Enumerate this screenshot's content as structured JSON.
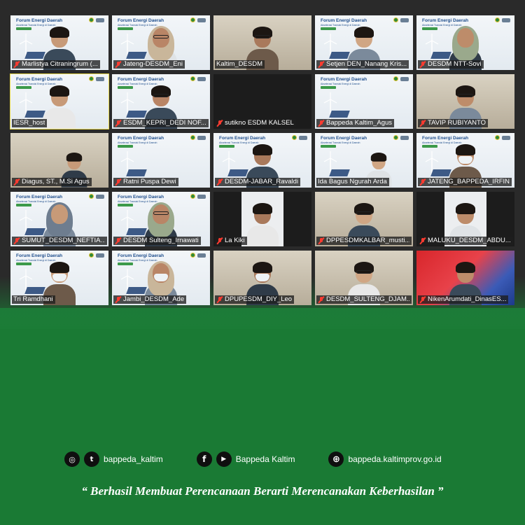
{
  "meeting": {
    "background_title": "Forum Energi Daerah",
    "background_subtitle": "Akselerasi Transisi Energi di Daerah",
    "participants": [
      {
        "name": "Marlistya Citraningrum (...",
        "muted": true,
        "bg": "forum",
        "person": "woman"
      },
      {
        "name": "Jateng-DESDM_Eni",
        "muted": true,
        "bg": "forum",
        "person": "hijab-glasses"
      },
      {
        "name": "Kaltim_DESDM",
        "muted": false,
        "bg": "room",
        "person": "man-glasses"
      },
      {
        "name": "Setjen DEN_Nanang Kris...",
        "muted": true,
        "bg": "forum",
        "person": "man"
      },
      {
        "name": "DESDM NTT-Sovi",
        "muted": true,
        "bg": "forum",
        "person": "hijab"
      },
      {
        "name": "IESR_host",
        "muted": false,
        "bg": "forum",
        "person": "woman",
        "highlight": true
      },
      {
        "name": "ESDM_KEPRI_DEDI NOF...",
        "muted": true,
        "bg": "forum",
        "person": "man-glasses"
      },
      {
        "name": "sutikno ESDM KALSEL",
        "muted": true,
        "bg": "dark",
        "person": "none"
      },
      {
        "name": "Bappeda Kaltim_Agus",
        "muted": true,
        "bg": "forum",
        "person": "none"
      },
      {
        "name": "TAVIP RUBIYANTO",
        "muted": true,
        "bg": "room",
        "person": "man-glasses"
      },
      {
        "name": "Diagus, ST., M.Si Agus",
        "muted": true,
        "bg": "room",
        "person": "man-small"
      },
      {
        "name": "Ratni Puspa Dewi",
        "muted": true,
        "bg": "forum",
        "person": "none"
      },
      {
        "name": "DESDM-JABAR_Ravaldi",
        "muted": true,
        "bg": "forum",
        "person": "man"
      },
      {
        "name": "Ida Bagus Ngurah Arda",
        "muted": false,
        "bg": "forum",
        "person": "man-small"
      },
      {
        "name": "JATENG_BAPPEDA_IRFIN",
        "muted": true,
        "bg": "forum",
        "person": "man-mask"
      },
      {
        "name": "SUMUT_DESDM_NEFTIA...",
        "muted": true,
        "bg": "forum",
        "person": "hijab"
      },
      {
        "name": "DESDM Sulteng_Irnawati",
        "muted": true,
        "bg": "forum",
        "person": "hijab-glasses"
      },
      {
        "name": "La Kiki",
        "muted": true,
        "bg": "dark",
        "person": "man"
      },
      {
        "name": "DPPESDMKALBAR_musti...",
        "muted": true,
        "bg": "room",
        "person": "man-glasses"
      },
      {
        "name": "MALUKU_DESDM_ABDU...",
        "muted": true,
        "bg": "dark",
        "person": "man"
      },
      {
        "name": "Tri Ramdhani",
        "muted": false,
        "bg": "forum",
        "person": "man-mask"
      },
      {
        "name": "Jambi_DESDM_Ade",
        "muted": true,
        "bg": "forum",
        "person": "hijab-mask"
      },
      {
        "name": "DPUPESDM_DIY_Leo",
        "muted": true,
        "bg": "room",
        "person": "man-mask"
      },
      {
        "name": "DESDM_SULTENG_DJAM...",
        "muted": true,
        "bg": "room",
        "person": "man-glasses"
      },
      {
        "name": "NikenArumdati_DinasES...",
        "muted": true,
        "bg": "poster",
        "person": "woman"
      }
    ]
  },
  "footer": {
    "social_handle": "bappeda_kaltim",
    "page_name": "Bappeda Kaltim",
    "website": "bappeda.kaltimprov.go.id",
    "slogan": "“ Berhasil  Membuat Perencanaan Berarti Merencanakan Keberhasilan ”"
  }
}
